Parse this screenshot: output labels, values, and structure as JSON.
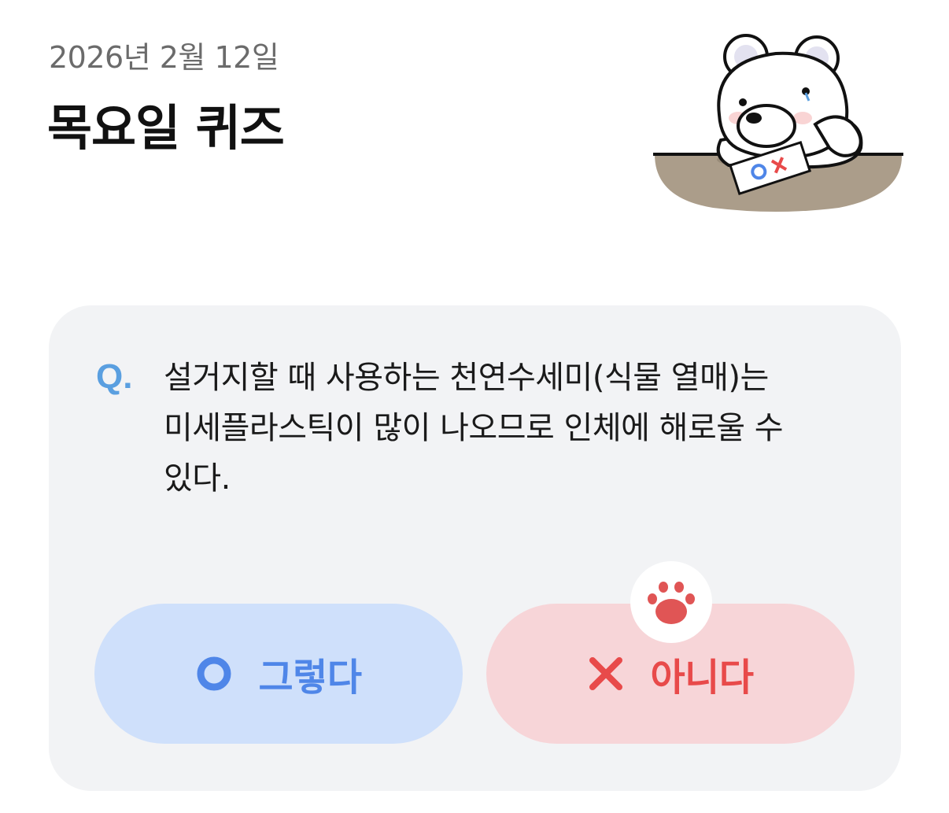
{
  "header": {
    "date": "2026년 2월 12일",
    "title": "목요일 퀴즈"
  },
  "illustration": {
    "name": "bear-thinking-illustration",
    "paper_text": "OX"
  },
  "quiz": {
    "q_label": "Q.",
    "question": "설거지할 때 사용하는 천연수세미(식물 열매)는 미세플라스틱이 많이 나오므로 인체에 해로울 수 있다.",
    "options": [
      {
        "label": "그렇다",
        "icon": "circle-o-icon",
        "color": "#4f86e8",
        "bg": "#cfe0fb"
      },
      {
        "label": "아니다",
        "icon": "x-mark-icon",
        "color": "#e84a4a",
        "bg": "#f7d5d8"
      }
    ],
    "selection_icon": "paw-icon"
  }
}
